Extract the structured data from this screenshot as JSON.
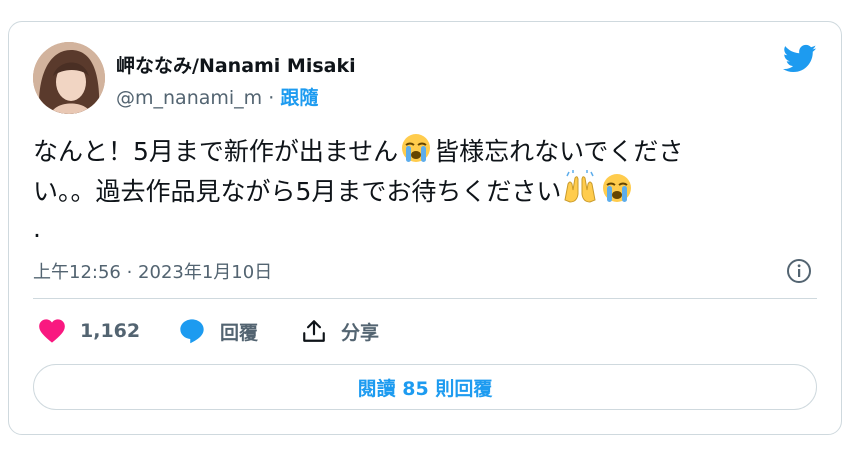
{
  "author": {
    "display_name": "岬ななみ/Nanami Misaki",
    "handle": "@m_nanami_m",
    "separator": " · ",
    "follow_label": "跟隨"
  },
  "tweet": {
    "line1_a": "なんと！5月まで新作が出ません",
    "line1_b": "皆様忘れないでくださ",
    "line2_a": "い。。過去作品見ながら5月までお待ちください",
    "line3": "."
  },
  "timestamp": "上午12:56 · 2023年1月10日",
  "actions": {
    "like_count": "1,162",
    "reply_label": "回覆",
    "share_label": "分享"
  },
  "read_replies_label": "閱讀 85 則回覆",
  "colors": {
    "accent": "#1d9bf0",
    "like": "#f91880",
    "border": "#cfd9de",
    "muted": "#536471"
  }
}
